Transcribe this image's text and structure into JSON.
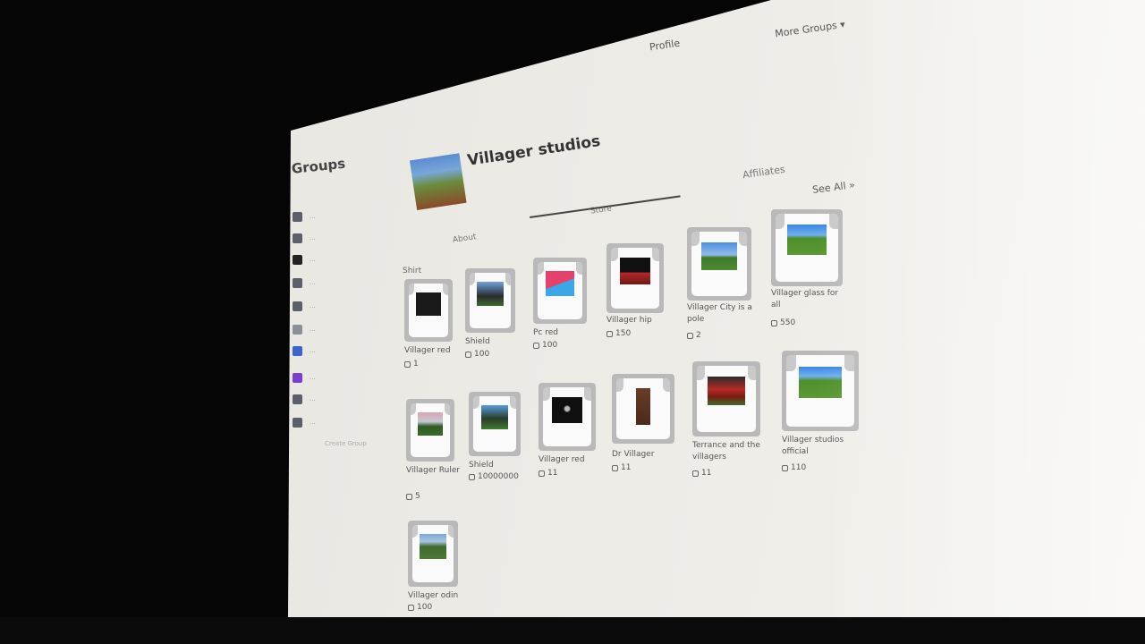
{
  "topnav": {
    "link1": "Profile",
    "link2": "More Groups ▾"
  },
  "sidebar": {
    "title": "Groups",
    "items": [
      {
        "icon": "group-icon",
        "label": "..."
      },
      {
        "icon": "group-icon",
        "label": "..."
      },
      {
        "icon": "group-icon",
        "label": "..."
      },
      {
        "icon": "group-icon",
        "label": "..."
      },
      {
        "icon": "group-icon",
        "label": "..."
      },
      {
        "icon": "group-icon",
        "label": "..."
      },
      {
        "icon": "group-icon",
        "label": "..."
      },
      {
        "icon": "group-icon",
        "label": "..."
      },
      {
        "icon": "group-icon",
        "label": "..."
      },
      {
        "icon": "group-icon",
        "label": "..."
      }
    ],
    "create_label": "Create Group"
  },
  "group": {
    "name": "Villager studios",
    "owner": "",
    "meta": ""
  },
  "tabs": {
    "about": "About",
    "store": "Store",
    "affiliates": "Affiliates",
    "see_all": "See All »"
  },
  "section": "Shirt",
  "items": [
    {
      "name": "Villager red",
      "price": "1",
      "art": "dark"
    },
    {
      "name": "Shield",
      "price": "100",
      "art": "sky"
    },
    {
      "name": "Pc red",
      "price": "100",
      "art": "pink"
    },
    {
      "name": "Villager hip",
      "price": "150",
      "art": "darkred"
    },
    {
      "name": "Villager City is a pole",
      "price": "2",
      "art": "sky"
    },
    {
      "name": "Villager glass for all",
      "price": "550",
      "art": "grass"
    },
    {
      "name": "Villager Ruler",
      "price": "5",
      "art": "dusk"
    },
    {
      "name": "Shield",
      "price": "10000000",
      "art": "sky"
    },
    {
      "name": "Villager red",
      "price": "11",
      "art": "blackfig"
    },
    {
      "name": "Dr Villager",
      "price": "11",
      "art": "brown"
    },
    {
      "name": "Terrance and the villagers",
      "price": "11",
      "art": "redhouse"
    },
    {
      "name": "Villager studios official",
      "price": "110",
      "art": "grass"
    },
    {
      "name": "Villager odin",
      "price": "100",
      "art": "grass"
    }
  ],
  "colors": {
    "tile": "#b9b9b9",
    "screen": "#ecebe6"
  }
}
